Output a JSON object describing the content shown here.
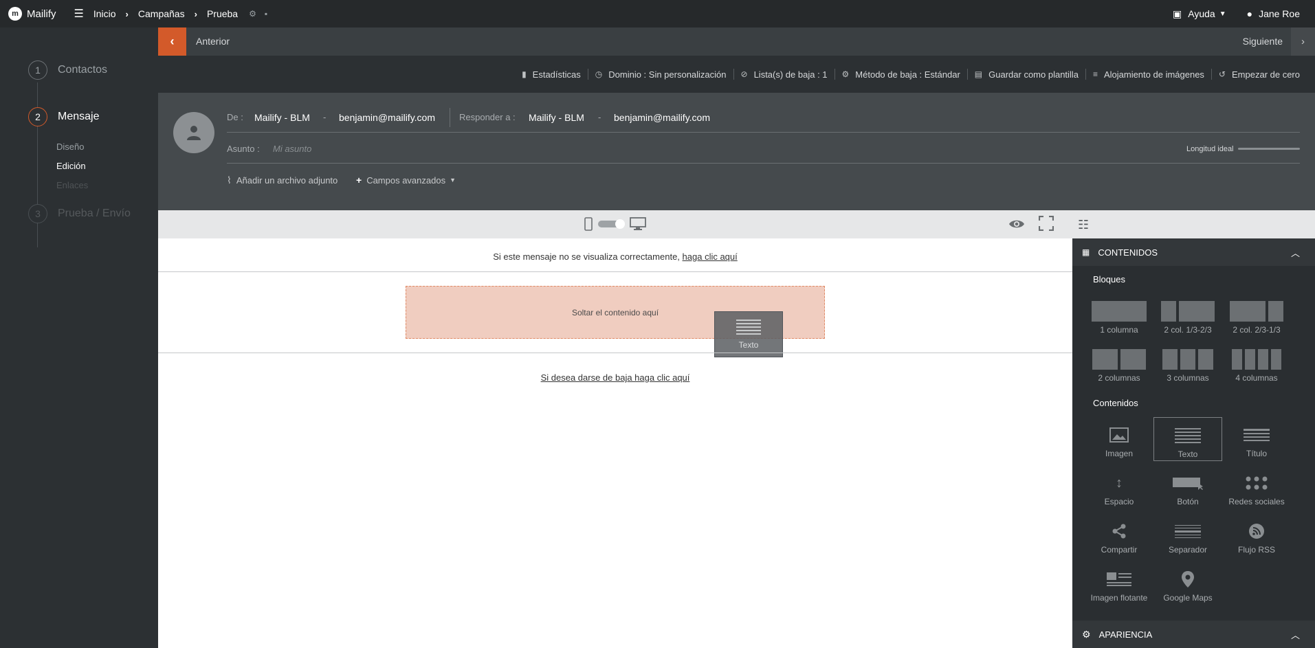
{
  "topbar": {
    "app_name": "Mailify",
    "breadcrumbs": [
      "Inicio",
      "Campañas",
      "Prueba"
    ],
    "help_label": "Ayuda",
    "user_name": "Jane Roe"
  },
  "steps": [
    {
      "num": "1",
      "label": "Contactos"
    },
    {
      "num": "2",
      "label": "Mensaje"
    },
    {
      "num": "3",
      "label": "Prueba / Envío"
    }
  ],
  "substeps": [
    "Diseño",
    "Edición",
    "Enlaces"
  ],
  "navbar": {
    "prev_label": "Anterior",
    "next_label": "Siguiente"
  },
  "toolbar": {
    "stats": "Estadísticas",
    "domain": "Dominio : Sin personalización",
    "unsub_lists": "Lista(s) de baja : 1",
    "unsub_method": "Método de baja : Estándar",
    "save_template": "Guardar como plantilla",
    "image_hosting": "Alojamiento de imágenes",
    "start_over": "Empezar de cero"
  },
  "header": {
    "from_label": "De :",
    "from_name": "Mailify - BLM",
    "from_email": "benjamin@mailify.com",
    "reply_label": "Responder a :",
    "reply_name": "Mailify - BLM",
    "reply_email": "benjamin@mailify.com",
    "dash": "-",
    "subject_label": "Asunto :",
    "subject_placeholder": "Mi asunto",
    "ideal_length_label": "Longitud ideal",
    "attach_label": "Añadir un archivo adjunto",
    "advanced_label": "Campos avanzados"
  },
  "canvas": {
    "view_msg": "Si este mensaje no se visualiza correctamente,",
    "view_link": "haga clic aquí",
    "dropzone_text": "Soltar el contenido aquí",
    "ghost_label": "Texto",
    "unsubscribe_text": "Si desea darse de baja haga clic aquí"
  },
  "rpanel": {
    "contents_header": "CONTENIDOS",
    "blocks_title": "Bloques",
    "blocks": [
      "1 columna",
      "2 col. 1/3-2/3",
      "2 col. 2/3-1/3",
      "2 columnas",
      "3 columnas",
      "4 columnas"
    ],
    "contents_title": "Contenidos",
    "contents": [
      "Imagen",
      "Texto",
      "Título",
      "Espacio",
      "Botón",
      "Redes sociales",
      "Compartir",
      "Separador",
      "Flujo RSS",
      "Imagen flotante",
      "Google Maps"
    ],
    "appearance_header": "APARIENCIA"
  },
  "colors": {
    "accent": "#d35a2a",
    "dropzone": "#f0cdc0"
  }
}
